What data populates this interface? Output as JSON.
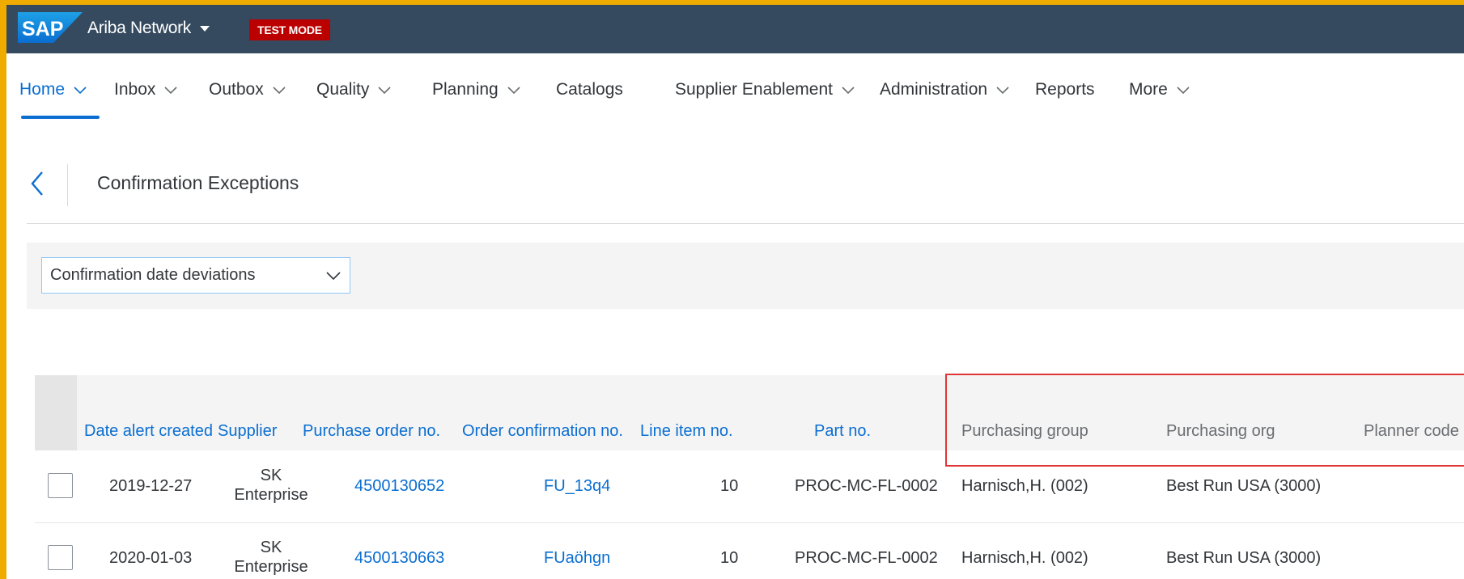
{
  "shell": {
    "logo_text": "SAP",
    "app_title": "Ariba Network",
    "mode_badge": "TEST MODE",
    "colors": {
      "shell_bg": "#354a5f",
      "frame": "#f0ab00",
      "badge": "#bb0000",
      "accent": "#0a6ed1"
    }
  },
  "nav": {
    "items": [
      {
        "label": "Home",
        "has_menu": true,
        "active": true
      },
      {
        "label": "Inbox",
        "has_menu": true
      },
      {
        "label": "Outbox",
        "has_menu": true
      },
      {
        "label": "Quality",
        "has_menu": true
      },
      {
        "label": "Planning",
        "has_menu": true
      },
      {
        "label": "Catalogs",
        "has_menu": false
      },
      {
        "label": "Supplier Enablement",
        "has_menu": true
      },
      {
        "label": "Administration",
        "has_menu": true
      },
      {
        "label": "Reports",
        "has_menu": false
      },
      {
        "label": "More",
        "has_menu": true
      }
    ]
  },
  "page": {
    "title": "Confirmation Exceptions",
    "back_icon": "chevron-left-icon"
  },
  "filter": {
    "selected": "Confirmation date deviations"
  },
  "table": {
    "columns": [
      "Date alert created",
      "Supplier",
      "Purchase order no.",
      "Order confirmation no.",
      "Line item no.",
      "Part no.",
      "Purchasing group",
      "Purchasing org",
      "Planner code"
    ],
    "rows": [
      {
        "date": "2019-12-27",
        "supplier": "SK Enterprise",
        "po": "4500130652",
        "oc": "FU_13q4",
        "line": "10",
        "part": "PROC-MC-FL-0002",
        "pgroup": "Harnisch,H. (002)",
        "porg": "Best Run USA (3000)",
        "planner": ""
      },
      {
        "date": "2020-01-03",
        "supplier": "SK Enterprise",
        "po": "4500130663",
        "oc": "FUaöhgn",
        "line": "10",
        "part": "PROC-MC-FL-0002",
        "pgroup": "Harnisch,H. (002)",
        "porg": "Best Run USA (3000)",
        "planner": ""
      }
    ]
  }
}
